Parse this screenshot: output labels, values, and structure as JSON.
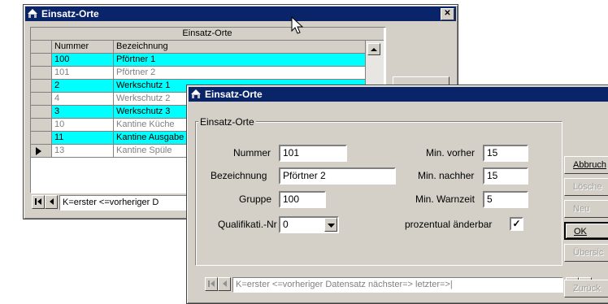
{
  "window1": {
    "title": "Einsatz-Orte",
    "close_glyph": "✕",
    "grid_caption": "Einsatz-Orte",
    "columns": [
      "Nummer",
      "Bezeichnung"
    ],
    "rows": [
      {
        "nummer": "100",
        "bez": "Pförtner 1",
        "style": "hl"
      },
      {
        "nummer": "101",
        "bez": "Pförtner 2",
        "style": "gr"
      },
      {
        "nummer": "2",
        "bez": "Werkschutz 1",
        "style": "hl"
      },
      {
        "nummer": "4",
        "bez": "Werkschutz 2",
        "style": "gr"
      },
      {
        "nummer": "3",
        "bez": "Werkschutz 3",
        "style": "hl"
      },
      {
        "nummer": "10",
        "bez": "Kantine Küche",
        "style": "gr"
      },
      {
        "nummer": "11",
        "bez": "Kantine Ausgabe",
        "style": "hl"
      },
      {
        "nummer": "13",
        "bez": "Kantine Spüle",
        "style": "gr"
      }
    ],
    "nav_text": "K=erster <=vorheriger D"
  },
  "window2": {
    "title": "Einsatz-Orte",
    "group_label": "Einsatz-Orte",
    "fields": {
      "nummer_label": "Nummer",
      "nummer_value": "101",
      "bezeichnung_label": "Bezeichnung",
      "bezeichnung_value": "Pförtner 2",
      "gruppe_label": "Gruppe",
      "gruppe_value": "100",
      "qualifikation_label": "Qualifikati.-Nr",
      "qualifikation_value": "0",
      "min_vorher_label": "Min. vorher",
      "min_vorher_value": "15",
      "min_nachher_label": "Min. nachher",
      "min_nachher_value": "15",
      "min_warnzeit_label": "Min. Warnzeit",
      "min_warnzeit_value": "5",
      "prozentual_label": "prozentual änderbar",
      "prozentual_checked": "✓"
    },
    "nav_text": "K=erster <=vorheriger Datensatz nächster=> letzter=>|"
  },
  "side_buttons": {
    "abbruch": "Abbruch",
    "loeschen": "Lösche",
    "neu": "Neu",
    "ok": "OK",
    "uebersicht": "Übersic",
    "zurueck": "Zurück"
  }
}
